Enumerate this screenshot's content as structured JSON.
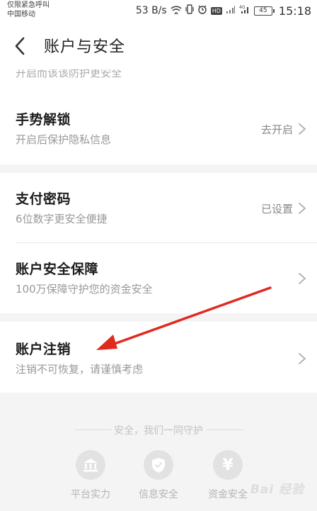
{
  "status_bar": {
    "carrier_line1": "仅限紧急呼叫",
    "carrier_line2": "中国移动",
    "net_speed": "53 B/s",
    "hd": "HD",
    "battery": "45",
    "time": "15:18",
    "icons": [
      "wifi-hotspot-icon",
      "vibrate-icon",
      "alarm-icon",
      "hd-icon",
      "signal-icon",
      "signal-4g-icon",
      "battery-icon"
    ]
  },
  "header": {
    "title": "账户与安全",
    "back_icon": "chevron-left-icon"
  },
  "clipped_row_text": "开启而该该防护更安全",
  "rows": [
    {
      "title": "手势解锁",
      "subtitle": "开启后保护隐私信息",
      "value": "去开启"
    },
    {
      "title": "支付密码",
      "subtitle": "6位数字更安全便捷",
      "value": "已设置"
    },
    {
      "title": "账户安全保障",
      "subtitle": "100万保障守护您的资金安全",
      "value": ""
    },
    {
      "title": "账户注销",
      "subtitle": "注销不可恢复，请谨慎考虑",
      "value": ""
    }
  ],
  "footer": {
    "slogan": "安全，我们一同守护",
    "features": [
      {
        "label": "平台实力",
        "icon": "bank-icon"
      },
      {
        "label": "信息安全",
        "icon": "shield-icon"
      },
      {
        "label": "资金安全",
        "icon": "yuan-icon",
        "glyph": "¥"
      }
    ]
  },
  "watermark": "Bai 经验",
  "colors": {
    "background": "#f4f4f4",
    "card": "#ffffff",
    "annotation_arrow": "#e02a20"
  }
}
